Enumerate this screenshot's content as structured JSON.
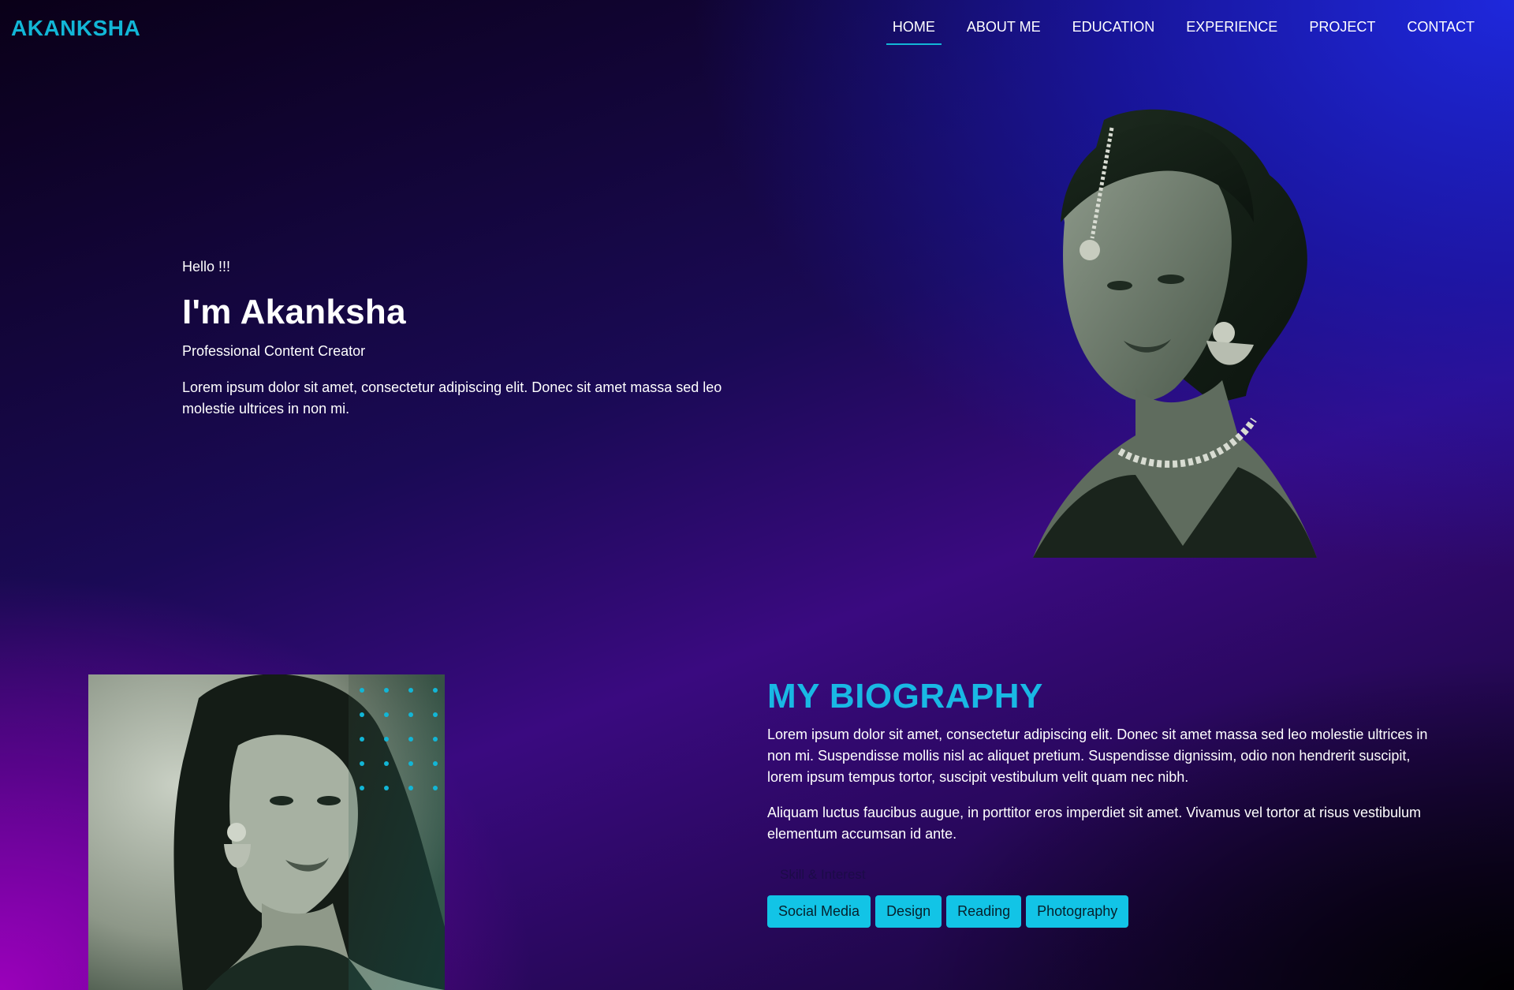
{
  "nav": {
    "logo": "AKANKSHA",
    "items": [
      {
        "label": "HOME",
        "active": true
      },
      {
        "label": "ABOUT ME"
      },
      {
        "label": "EDUCATION"
      },
      {
        "label": "EXPERIENCE"
      },
      {
        "label": "PROJECT"
      },
      {
        "label": "CONTACT"
      }
    ]
  },
  "hero": {
    "greeting": "Hello !!!",
    "name": "I'm Akanksha",
    "role": "Professional Content Creator",
    "intro": "Lorem ipsum dolor sit amet, consectetur adipiscing elit. Donec sit amet massa sed leo molestie ultrices in non mi."
  },
  "bio": {
    "title": "MY BIOGRAPHY",
    "paragraph1": "Lorem ipsum dolor sit amet, consectetur adipiscing elit. Donec sit amet massa sed leo molestie ultrices in non mi. Suspendisse mollis nisl ac aliquet pretium. Suspendisse dignissim, odio non hendrerit suscipit, lorem ipsum tempus tortor, suscipit vestibulum velit quam nec nibh.",
    "paragraph2": "Aliquam luctus faucibus augue, in porttitor eros imperdiet sit amet. Vivamus vel tortor at risus vestibulum elementum accumsan id ante.",
    "skills_label": "Skill & Interest",
    "skills": [
      "Social Media",
      "Design",
      "Reading",
      "Photography"
    ]
  },
  "colors": {
    "accent": "#12b6d6",
    "chip": "#12c4e6"
  }
}
